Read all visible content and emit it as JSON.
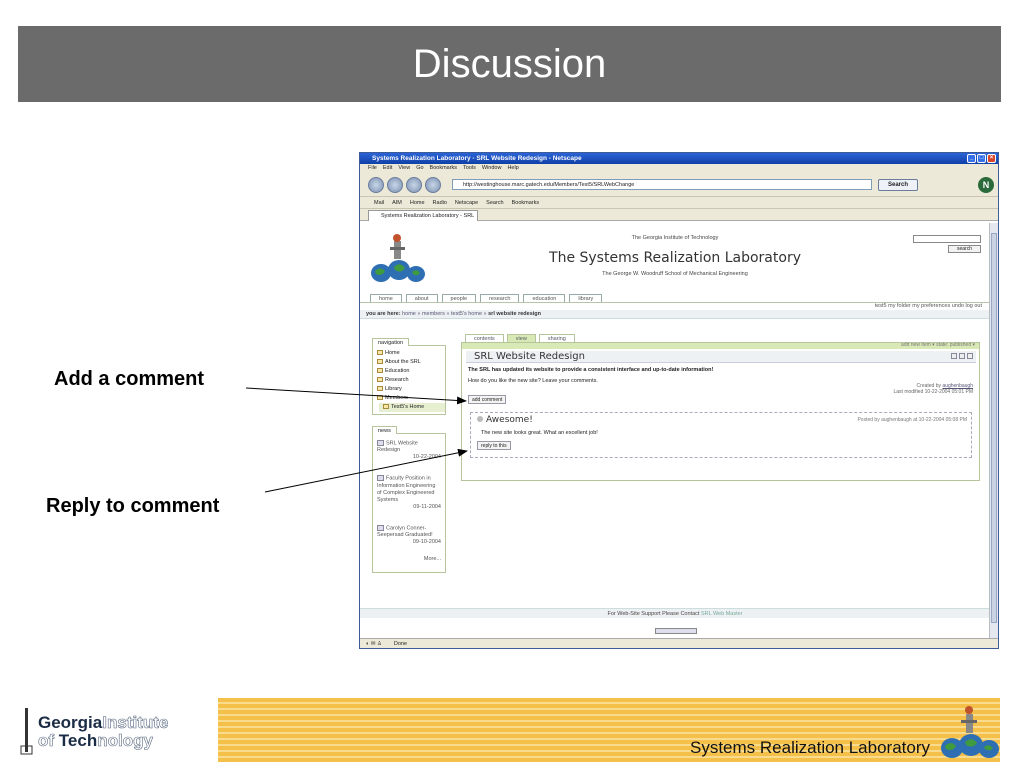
{
  "slide": {
    "title": "Discussion",
    "annotations": {
      "add_comment": "Add a comment",
      "reply_to_comment": "Reply to comment"
    },
    "footer_brand": {
      "gt_line1_bold": "Georgia",
      "gt_line1_light": "Institute",
      "gt_line2_light": "of ",
      "gt_line2_bold": "Tech",
      "gt_line2_rest": "nology",
      "srl_text": "Systems Realization Laboratory"
    }
  },
  "browser": {
    "window_title": "Systems Realization Laboratory - SRL Website Redesign - Netscape",
    "menu": [
      "File",
      "Edit",
      "View",
      "Go",
      "Bookmarks",
      "Tools",
      "Window",
      "Help"
    ],
    "url": "http://westinghouse.marc.gatech.edu/Members/Test5/SRLWebChange",
    "search_label": "Search",
    "bookmarks": [
      "Mail",
      "AIM",
      "Home",
      "Radio",
      "Netscape",
      "Search",
      "Bookmarks"
    ],
    "tab_label": "Systems Realization Laboratory - SRL Web...",
    "status": "Done"
  },
  "site": {
    "institute": "The Georgia Institute of Technology",
    "lab_name": "The Systems Realization Laboratory",
    "school": "The George W. Woodruff School of Mechanical Engineering",
    "search_button": "search",
    "tabs": [
      "home",
      "about",
      "people",
      "research",
      "education",
      "library"
    ],
    "user_actions": "test5   my folder   my preferences   undo   log out",
    "breadcrumb_prefix": "you are here:",
    "breadcrumb": "home » members » test5's home »",
    "breadcrumb_current": "srl website redesign",
    "navigation": {
      "header": "navigation",
      "items": [
        "Home",
        "About the SRL",
        "Education",
        "Research",
        "Library",
        "Members",
        "Test5's Home"
      ]
    },
    "news": {
      "header": "news",
      "items": [
        {
          "title": "SRL Website Redesign",
          "date": "10-22-2004"
        },
        {
          "title": "Faculty Position in Information Engineering of Complex Engineered Systems",
          "date": "09-11-2004"
        },
        {
          "title": "Carolyn Conner-Seepersad Graduated!",
          "date": "09-10-2004"
        }
      ],
      "more": "More..."
    },
    "content_tabs": [
      "contents",
      "view",
      "sharing"
    ],
    "content_bar": "add new item  ▾   state: published ▾",
    "item_title": "SRL Website Redesign",
    "item_description": "The SRL has updated its website to provide a consistent interface and up-to-date information!",
    "item_body": "How do you like the new site?  Leave your comments.",
    "created_by_label": "Created by",
    "created_by": "aughenbaugh",
    "last_modified": "Last modified 10-22-2004 05:01 PM",
    "add_comment_button": "add comment",
    "comment": {
      "title": "Awesome!",
      "posted": "Posted by aughenbaugh at 10-22-2004 05:08 PM",
      "body": "The new site looks great.  What an excellent job!",
      "reply_button": "reply to this"
    },
    "footer_text": "For Web-Site Support Please Contact",
    "footer_link": "SRL Web Master"
  }
}
